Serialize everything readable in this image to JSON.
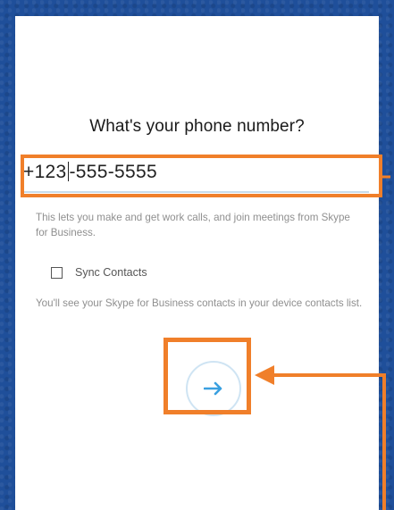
{
  "colors": {
    "background": "#1f4f9a",
    "highlight": "#f07f2a",
    "accent": "#3aa0e0"
  },
  "screen": {
    "title": "What's your phone number?",
    "phone": {
      "value_before_cursor": "+123",
      "value_after_cursor": "-555-5555"
    },
    "helper_text": "This lets you make and get work calls, and join meetings from Skype for Business.",
    "sync": {
      "label": "Sync Contacts",
      "checked": false,
      "description": "You'll see your Skype for Business contacts in your device contacts list."
    },
    "next_button": {
      "icon": "arrow-right-icon"
    }
  }
}
